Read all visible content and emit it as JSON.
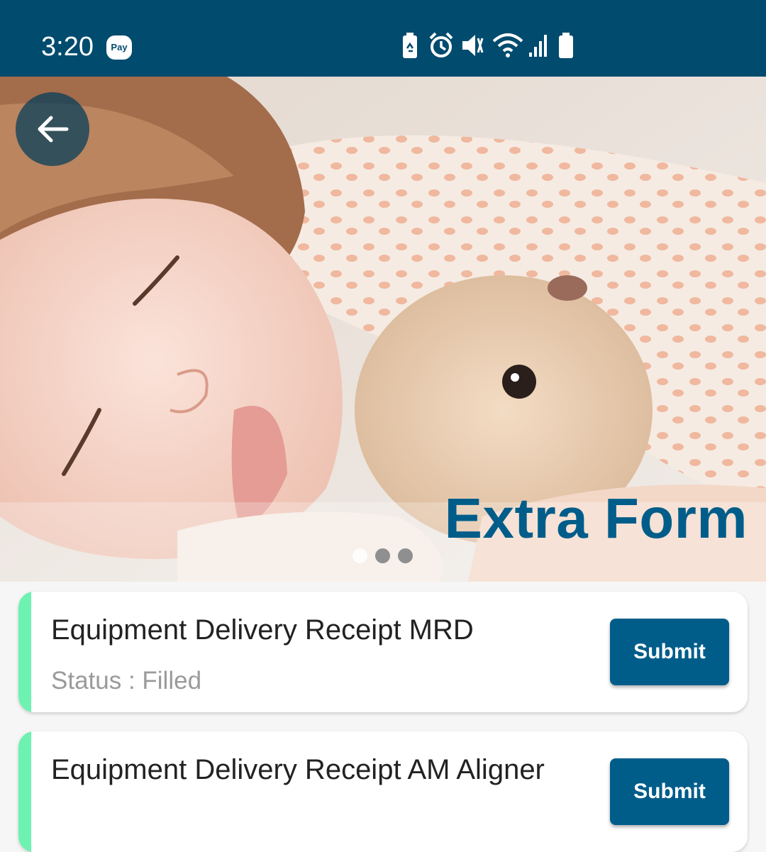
{
  "status_bar": {
    "time": "3:20",
    "pay_badge": "Pay",
    "icons": [
      "battery-saver-icon",
      "alarm-icon",
      "vibrate-icon",
      "wifi-icon",
      "signal-icon",
      "battery-icon"
    ],
    "background_color": "#004b6e"
  },
  "hero": {
    "title": "Extra Form",
    "back_icon": "arrow-left-icon",
    "carousel_dots": 3,
    "active_dot": 0,
    "title_color": "#005d8a"
  },
  "forms": [
    {
      "title": "Equipment Delivery Receipt MRD",
      "status": "Status : Filled",
      "button": "Submit",
      "accent_color": "#6df2b1"
    },
    {
      "title": "Equipment Delivery Receipt AM Aligner",
      "status": "",
      "button": "Submit",
      "accent_color": "#6df2b1"
    }
  ]
}
